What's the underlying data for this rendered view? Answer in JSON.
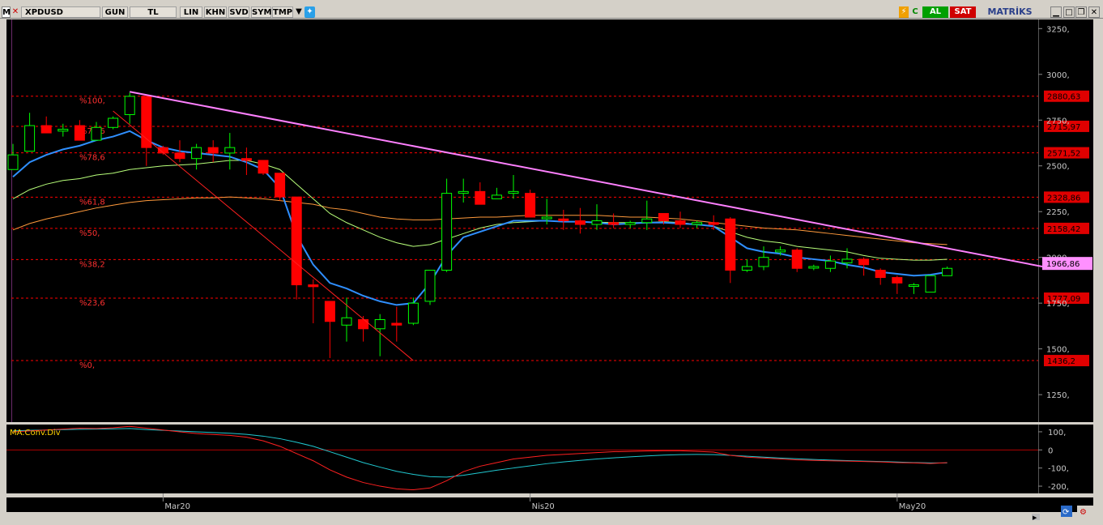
{
  "toolbar": {
    "logo": "M",
    "symbol": "XPDUSD",
    "buttons": [
      "GUN",
      "TL",
      "LIN",
      "KHN",
      "SVD",
      "SYM",
      "TMP"
    ],
    "buy_label": "AL",
    "sell_label": "SAT",
    "brand": "MATRİKS"
  },
  "colors": {
    "background": "#000000",
    "bull_candle": "#00ff00",
    "bear_candle": "#ff0000",
    "ma_fast": "#2f8fff",
    "ma_mid": "#b8ff7a",
    "ma_slow": "#ff9a3c",
    "trendline": "#ff80ff",
    "fib_line": "#ff0000",
    "macd": "#ff2020",
    "signal": "#20c8d0"
  },
  "chart_data": {
    "type": "candlestick",
    "symbol": "XPDUSD",
    "ylim": [
      1100,
      3300
    ],
    "y_ticks": [
      "3250,",
      "3000,",
      "2750,",
      "2500,",
      "2250,",
      "2000,",
      "1750,",
      "1500,",
      "1250,"
    ],
    "y_tick_values": [
      3250,
      3000,
      2750,
      2500,
      2250,
      2000,
      1750,
      1500,
      1250
    ],
    "x_labels": [
      "Mar20",
      "Nis20",
      "May20"
    ],
    "x_label_index": [
      9,
      31,
      53
    ],
    "fibonacci": [
      {
        "label": "%100,",
        "price": 2880.63,
        "price_label": "2880,63"
      },
      {
        "label": "%78,6",
        "price": 2715.97,
        "price_label": "2715,97"
      },
      {
        "label": "%78,6",
        "price": 2571.52,
        "price_label": "2571,52"
      },
      {
        "label": "%61,8",
        "price": 2328.86,
        "price_label": "2328,86"
      },
      {
        "label": "%50,",
        "price": 2158.42,
        "price_label": "2158,42"
      },
      {
        "label": "%38,2",
        "price": 1988.0,
        "price_label": ""
      },
      {
        "label": "%23,6",
        "price": 1777.09,
        "price_label": "1777,09"
      },
      {
        "label": "%0,",
        "price": 1436.2,
        "price_label": "1436,2"
      }
    ],
    "last_price": 1966.86,
    "last_price_label": "1966,86",
    "candles": [
      [
        2480,
        2620,
        2480,
        2560
      ],
      [
        2580,
        2790,
        2580,
        2720
      ],
      [
        2720,
        2770,
        2690,
        2680
      ],
      [
        2690,
        2730,
        2660,
        2700
      ],
      [
        2720,
        2750,
        2640,
        2640
      ],
      [
        2640,
        2740,
        2640,
        2710
      ],
      [
        2710,
        2770,
        2700,
        2760
      ],
      [
        2780,
        2900,
        2730,
        2880
      ],
      [
        2880,
        2880,
        2500,
        2600
      ],
      [
        2600,
        2610,
        2560,
        2570
      ],
      [
        2570,
        2640,
        2520,
        2540
      ],
      [
        2540,
        2620,
        2480,
        2600
      ],
      [
        2600,
        2640,
        2520,
        2570
      ],
      [
        2570,
        2680,
        2480,
        2600
      ],
      [
        2540,
        2600,
        2450,
        2530
      ],
      [
        2530,
        2530,
        2450,
        2460
      ],
      [
        2460,
        2460,
        2310,
        2330
      ],
      [
        2330,
        2330,
        1770,
        1850
      ],
      [
        1850,
        1880,
        1640,
        1840
      ],
      [
        1760,
        1760,
        1450,
        1650
      ],
      [
        1630,
        1780,
        1540,
        1670
      ],
      [
        1660,
        1680,
        1540,
        1610
      ],
      [
        1610,
        1690,
        1460,
        1660
      ],
      [
        1640,
        1730,
        1540,
        1630
      ],
      [
        1640,
        1780,
        1630,
        1750
      ],
      [
        1760,
        1910,
        1740,
        1930
      ],
      [
        1930,
        2430,
        1920,
        2350
      ],
      [
        2350,
        2430,
        2300,
        2360
      ],
      [
        2360,
        2410,
        2290,
        2290
      ],
      [
        2320,
        2380,
        2320,
        2340
      ],
      [
        2350,
        2450,
        2320,
        2360
      ],
      [
        2350,
        2370,
        2220,
        2220
      ],
      [
        2220,
        2320,
        2180,
        2220
      ],
      [
        2210,
        2260,
        2150,
        2200
      ],
      [
        2200,
        2270,
        2130,
        2180
      ],
      [
        2180,
        2290,
        2150,
        2200
      ],
      [
        2190,
        2240,
        2160,
        2180
      ],
      [
        2180,
        2200,
        2160,
        2190
      ],
      [
        2190,
        2310,
        2150,
        2210
      ],
      [
        2240,
        2240,
        2180,
        2200
      ],
      [
        2200,
        2250,
        2160,
        2180
      ],
      [
        2180,
        2200,
        2160,
        2190
      ],
      [
        2190,
        2230,
        2150,
        2180
      ],
      [
        2210,
        2220,
        1860,
        1930
      ],
      [
        1930,
        1990,
        1920,
        1950
      ],
      [
        1950,
        2060,
        1930,
        2000
      ],
      [
        2030,
        2060,
        2010,
        2040
      ],
      [
        2040,
        2050,
        1920,
        1940
      ],
      [
        1950,
        1960,
        1930,
        1950
      ],
      [
        1940,
        2010,
        1920,
        1980
      ],
      [
        1970,
        2050,
        1940,
        1990
      ],
      [
        1990,
        2000,
        1900,
        1960
      ],
      [
        1930,
        1940,
        1850,
        1890
      ],
      [
        1890,
        1900,
        1800,
        1860
      ],
      [
        1850,
        1860,
        1800,
        1850
      ],
      [
        1810,
        1890,
        1810,
        1900
      ],
      [
        1900,
        1950,
        1900,
        1940
      ]
    ],
    "ma_fast": [
      2440,
      2520,
      2560,
      2590,
      2610,
      2640,
      2660,
      2690,
      2640,
      2600,
      2580,
      2570,
      2560,
      2550,
      2520,
      2480,
      2380,
      2120,
      1960,
      1860,
      1830,
      1790,
      1760,
      1740,
      1750,
      1860,
      2010,
      2110,
      2140,
      2170,
      2200,
      2200,
      2200,
      2195,
      2195,
      2190,
      2180,
      2185,
      2190,
      2190,
      2185,
      2180,
      2170,
      2110,
      2050,
      2030,
      2020,
      2000,
      1990,
      1980,
      1960,
      1945,
      1920,
      1910,
      1900,
      1905,
      1920
    ],
    "ma_mid": [
      2320,
      2370,
      2400,
      2420,
      2430,
      2450,
      2460,
      2480,
      2490,
      2500,
      2505,
      2510,
      2520,
      2530,
      2530,
      2510,
      2480,
      2400,
      2320,
      2240,
      2190,
      2150,
      2110,
      2080,
      2060,
      2070,
      2100,
      2130,
      2160,
      2180,
      2190,
      2195,
      2200,
      2195,
      2195,
      2192,
      2190,
      2190,
      2190,
      2195,
      2190,
      2180,
      2170,
      2140,
      2110,
      2090,
      2080,
      2060,
      2050,
      2040,
      2030,
      2010,
      1995,
      1990,
      1985,
      1985,
      1990
    ],
    "ma_slow": [
      2150,
      2185,
      2210,
      2230,
      2250,
      2270,
      2285,
      2300,
      2310,
      2315,
      2320,
      2325,
      2325,
      2330,
      2325,
      2320,
      2310,
      2300,
      2290,
      2270,
      2260,
      2240,
      2220,
      2210,
      2205,
      2205,
      2210,
      2215,
      2220,
      2220,
      2225,
      2230,
      2230,
      2230,
      2230,
      2230,
      2225,
      2220,
      2220,
      2215,
      2210,
      2200,
      2190,
      2180,
      2170,
      2160,
      2155,
      2150,
      2140,
      2130,
      2120,
      2110,
      2100,
      2090,
      2080,
      2075,
      2070
    ],
    "trendline": {
      "from": {
        "index": 7,
        "price": 2905
      },
      "to": {
        "index": 60,
        "price": 1970
      }
    },
    "retrace_line": {
      "from": {
        "index": 6,
        "price": 2800
      },
      "to": {
        "index": 24,
        "price": 1436
      }
    },
    "indicator": {
      "name": "MA.Conv.Div",
      "ylim": [
        -240,
        140
      ],
      "ticks": [
        "100,",
        "0",
        "-100,",
        "-200,"
      ],
      "tick_values": [
        100,
        0,
        -100,
        -200
      ],
      "macd": [
        100,
        105,
        110,
        115,
        120,
        118,
        122,
        130,
        120,
        110,
        100,
        90,
        85,
        80,
        70,
        50,
        20,
        -20,
        -60,
        -110,
        -150,
        -180,
        -200,
        -215,
        -220,
        -210,
        -170,
        -120,
        -90,
        -70,
        -50,
        -40,
        -30,
        -25,
        -20,
        -15,
        -10,
        -8,
        -6,
        -5,
        -5,
        -8,
        -12,
        -30,
        -40,
        -45,
        -50,
        -55,
        -58,
        -60,
        -62,
        -64,
        -66,
        -70,
        -72,
        -75,
        -70
      ],
      "signal": [
        105,
        108,
        110,
        112,
        114,
        115,
        116,
        118,
        112,
        108,
        104,
        100,
        96,
        92,
        86,
        76,
        62,
        42,
        20,
        -10,
        -40,
        -70,
        -95,
        -118,
        -135,
        -148,
        -150,
        -140,
        -126,
        -112,
        -100,
        -88,
        -76,
        -66,
        -58,
        -50,
        -44,
        -38,
        -33,
        -29,
        -26,
        -25,
        -26,
        -30,
        -35,
        -40,
        -45,
        -49,
        -53,
        -56,
        -59,
        -62,
        -64,
        -67,
        -70,
        -72,
        -72
      ]
    }
  }
}
